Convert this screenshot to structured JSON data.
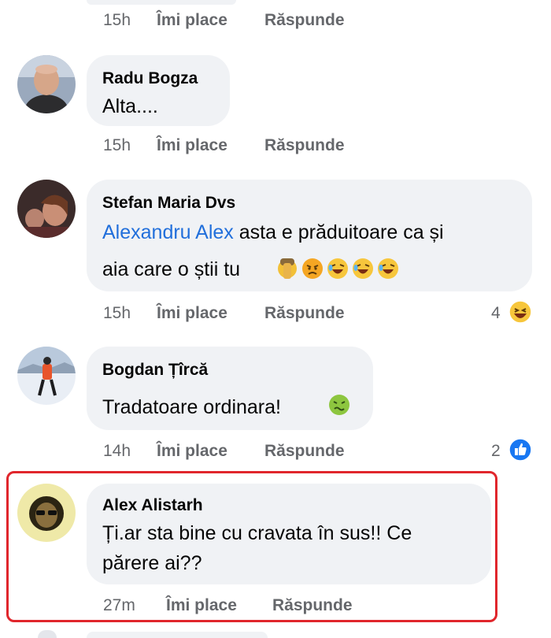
{
  "comments": [
    {
      "author": "",
      "text": "",
      "time": "15h",
      "like_label": "Îmi place",
      "reply_label": "Răspunde"
    },
    {
      "author": "Radu Bogza",
      "text": "Alta....",
      "time": "15h",
      "like_label": "Îmi place",
      "reply_label": "Răspunde"
    },
    {
      "author": "Stefan Maria Dvs",
      "mention": "Alexandru Alex",
      "text_line1": " asta e prăduitoare ca și",
      "text_line2": "aia care o știi tu",
      "emojis": [
        "facepalm-emoji",
        "angry-emoji",
        "rofl-emoji",
        "rofl-emoji",
        "rofl-emoji"
      ],
      "time": "15h",
      "like_label": "Îmi place",
      "reply_label": "Răspunde",
      "reaction_count": "4",
      "reaction_icon": "laugh-reaction-icon"
    },
    {
      "author": "Bogdan Țîrcă",
      "text": "Tradatoare ordinara!",
      "emojis": [
        "nauseated-emoji"
      ],
      "time": "14h",
      "like_label": "Îmi place",
      "reply_label": "Răspunde",
      "reaction_count": "2",
      "reaction_icon": "like-reaction-icon"
    },
    {
      "author": "Alex Alistarh",
      "text_line1": "Ți.ar sta bine cu cravata în sus!! Ce",
      "text_line2": "părere ai??",
      "time": "27m",
      "like_label": "Îmi place",
      "reply_label": "Răspunde"
    }
  ],
  "colors": {
    "bubble": "#f0f2f5",
    "meta_text": "#65676b",
    "mention": "#216fdb",
    "highlight_border": "#e0262c",
    "like_blue": "#1877f2"
  }
}
